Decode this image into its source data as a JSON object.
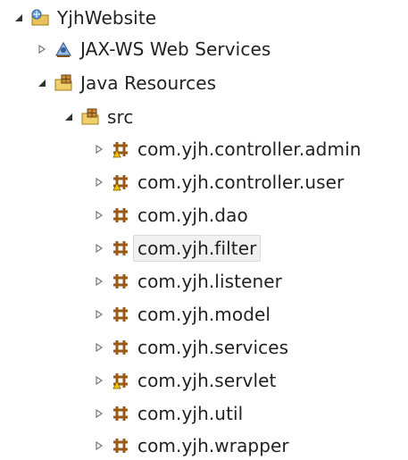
{
  "tree": {
    "project": {
      "label": "YjhWebsite",
      "expanded": true,
      "icon": "web-project-icon"
    },
    "jaxws": {
      "label": "JAX-WS Web Services",
      "expanded": false,
      "icon": "web-services-icon"
    },
    "java_resources": {
      "label": "Java Resources",
      "expanded": true,
      "icon": "java-resources-icon"
    },
    "src": {
      "label": "src",
      "expanded": true,
      "icon": "source-folder-icon"
    },
    "packages": [
      {
        "label": "com.yjh.controller.admin",
        "icon": "package-warning-icon"
      },
      {
        "label": "com.yjh.controller.user",
        "icon": "package-warning-icon"
      },
      {
        "label": "com.yjh.dao",
        "icon": "package-icon"
      },
      {
        "label": "com.yjh.filter",
        "icon": "package-icon",
        "selected": true
      },
      {
        "label": "com.yjh.listener",
        "icon": "package-icon"
      },
      {
        "label": "com.yjh.model",
        "icon": "package-icon"
      },
      {
        "label": "com.yjh.services",
        "icon": "package-icon"
      },
      {
        "label": "com.yjh.servlet",
        "icon": "package-warning-icon"
      },
      {
        "label": "com.yjh.util",
        "icon": "package-icon"
      },
      {
        "label": "com.yjh.wrapper",
        "icon": "package-icon"
      }
    ]
  }
}
